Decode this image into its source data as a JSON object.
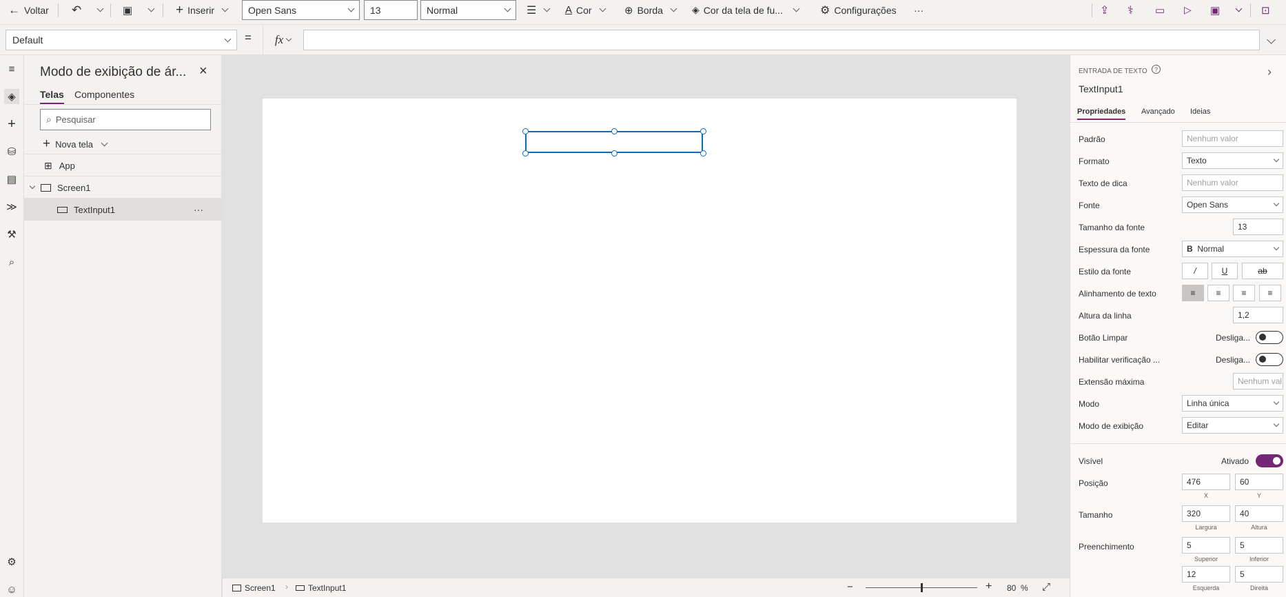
{
  "commandbar": {
    "back_label": "Voltar",
    "insert_label": "Inserir",
    "font_value": "Open Sans",
    "size_value": "13",
    "weight_value": "Normal",
    "color_label": "Cor",
    "border_label": "Borda",
    "fill_label": "Cor da tela de fu...",
    "settings_label": "Configurações",
    "more_label": "···"
  },
  "formulabar": {
    "property_value": "Default",
    "equals": "=",
    "fx": "fx",
    "formula_value": ""
  },
  "tree": {
    "title": "Modo de exibição de ár...",
    "tabs": [
      "Telas",
      "Componentes"
    ],
    "search_placeholder": "Pesquisar",
    "new_screen_label": "Nova tela",
    "items": [
      {
        "label": "App"
      },
      {
        "label": "Screen1"
      },
      {
        "label": "TextInput1",
        "more": "···"
      }
    ]
  },
  "bottombar": {
    "screen_label": "Screen1",
    "control_label": "TextInput1",
    "zoom_value": "80",
    "zoom_unit": "%",
    "zoom_level": 0.5
  },
  "properties": {
    "control_type": "ENTRADA DE TEXTO",
    "control_name": "TextInput1",
    "tabs": [
      "Propriedades",
      "Avançado",
      "Ideias"
    ],
    "rows": {
      "padrao": {
        "label": "Padrão",
        "value": "Nenhum valor"
      },
      "formato": {
        "label": "Formato",
        "value": "Texto"
      },
      "dica": {
        "label": "Texto de dica",
        "value": "Nenhum valor"
      },
      "fonte": {
        "label": "Fonte",
        "value": "Open Sans"
      },
      "tamanho_fonte": {
        "label": "Tamanho da fonte",
        "value": "13"
      },
      "espessura": {
        "label": "Espessura da fonte",
        "value": "Normal",
        "prefix": "B"
      },
      "estilo": {
        "label": "Estilo da fonte"
      },
      "alinhamento": {
        "label": "Alinhamento de texto"
      },
      "altura_linha": {
        "label": "Altura da linha",
        "value": "1,2"
      },
      "botao_limpar": {
        "label": "Botão Limpar",
        "state": "Desliga..."
      },
      "verificacao": {
        "label": "Habilitar verificação ...",
        "state": "Desliga..."
      },
      "extensao": {
        "label": "Extensão máxima",
        "value": "Nenhum val"
      },
      "modo": {
        "label": "Modo",
        "value": "Linha única"
      },
      "modo_exibicao": {
        "label": "Modo de exibição",
        "value": "Editar"
      },
      "visivel": {
        "label": "Visível",
        "state": "Ativado"
      },
      "posicao": {
        "label": "Posição",
        "x": "476",
        "y": "60",
        "x_label": "X",
        "y_label": "Y"
      },
      "tamanho": {
        "label": "Tamanho",
        "w": "320",
        "h": "40",
        "w_label": "Largura",
        "h_label": "Altura"
      },
      "preenchimento": {
        "label": "Preenchimento",
        "top": "5",
        "bottom": "5",
        "left": "12",
        "right": "5",
        "top_label": "Superior",
        "bottom_label": "Inferior",
        "left_label": "Esquerda",
        "right_label": "Direita"
      }
    }
  },
  "colors": {
    "accent": "#742774",
    "selection": "#0f6cbd"
  }
}
